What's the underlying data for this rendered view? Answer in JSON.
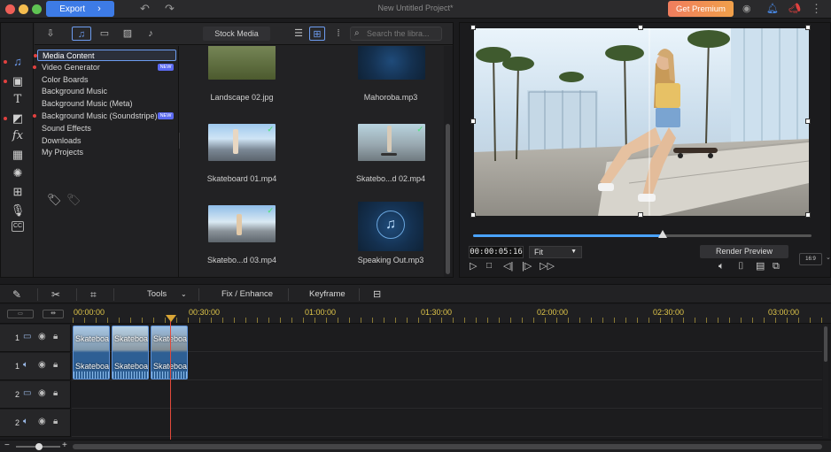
{
  "titlebar": {
    "export_label": "Export",
    "project_title": "New Untitled Project*",
    "premium_label": "Get Premium"
  },
  "library": {
    "stock_media_label": "Stock Media",
    "search_placeholder": "Search the libra...",
    "tree": [
      {
        "label": "Media Content",
        "selected": true,
        "dot": true,
        "new": false
      },
      {
        "label": "Video Generator",
        "selected": false,
        "dot": true,
        "new": true
      },
      {
        "label": "Color Boards",
        "selected": false,
        "dot": false,
        "new": false
      },
      {
        "label": "Background Music",
        "selected": false,
        "dot": false,
        "new": false
      },
      {
        "label": "Background Music (Meta)",
        "selected": false,
        "dot": false,
        "new": false
      },
      {
        "label": "Background Music (Soundstripe)",
        "selected": false,
        "dot": true,
        "new": true
      },
      {
        "label": "Sound Effects",
        "selected": false,
        "dot": false,
        "new": false
      },
      {
        "label": "Downloads",
        "selected": false,
        "dot": false,
        "new": false
      },
      {
        "label": "My Projects",
        "selected": false,
        "dot": false,
        "new": false
      }
    ],
    "new_badge": "NEW",
    "media": [
      {
        "label": "Landscape 02.jpg"
      },
      {
        "label": "Mahoroba.mp3"
      },
      {
        "label": "Skateboard 01.mp4"
      },
      {
        "label": "Skatebo...d 02.mp4"
      },
      {
        "label": "Skatebo...d 03.mp4"
      },
      {
        "label": "Speaking Out.mp3"
      }
    ]
  },
  "preview": {
    "timecode": "00:00:05:16",
    "fit_value": "Fit",
    "render_label": "Render Preview",
    "ratio_label": "16:9",
    "progress": 0.56
  },
  "timeline": {
    "tools_label": "Tools",
    "fix_label": "Fix / Enhance",
    "keyframe_label": "Keyframe",
    "ruler": [
      "00:00:00",
      "00:30:00",
      "01:00:00",
      "01:30:00",
      "02:00:00",
      "02:30:00",
      "03:00:00"
    ],
    "tracks": [
      {
        "num": "1",
        "type": "video"
      },
      {
        "num": "1",
        "type": "audio"
      },
      {
        "num": "2",
        "type": "video"
      },
      {
        "num": "2",
        "type": "audio"
      }
    ],
    "clip_label": "Skateboa"
  }
}
